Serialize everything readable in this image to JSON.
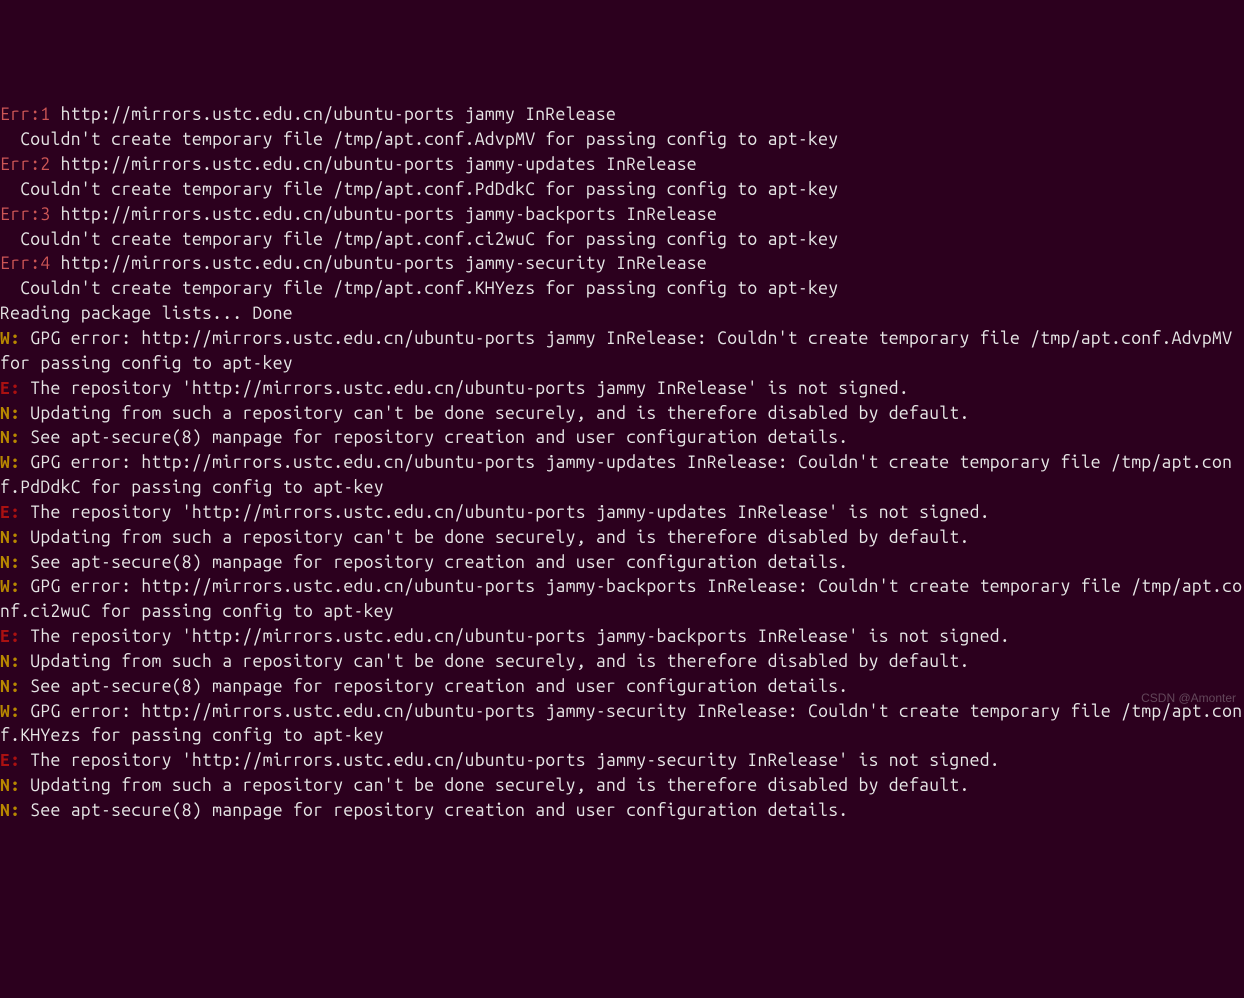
{
  "lines": [
    {
      "type": "err",
      "prefix": "Err:1",
      "text": " http://mirrors.ustc.edu.cn/ubuntu-ports jammy InRelease"
    },
    {
      "type": "plain",
      "text": "  Couldn't create temporary file /tmp/apt.conf.AdvpMV for passing config to apt-key"
    },
    {
      "type": "err",
      "prefix": "Err:2",
      "text": " http://mirrors.ustc.edu.cn/ubuntu-ports jammy-updates InRelease"
    },
    {
      "type": "plain",
      "text": "  Couldn't create temporary file /tmp/apt.conf.PdDdkC for passing config to apt-key"
    },
    {
      "type": "err",
      "prefix": "Err:3",
      "text": " http://mirrors.ustc.edu.cn/ubuntu-ports jammy-backports InRelease"
    },
    {
      "type": "plain",
      "text": "  Couldn't create temporary file /tmp/apt.conf.ci2wuC for passing config to apt-key"
    },
    {
      "type": "err",
      "prefix": "Err:4",
      "text": " http://mirrors.ustc.edu.cn/ubuntu-ports jammy-security InRelease"
    },
    {
      "type": "plain",
      "text": "  Couldn't create temporary file /tmp/apt.conf.KHYezs for passing config to apt-key"
    },
    {
      "type": "plain",
      "text": "Reading package lists... Done"
    },
    {
      "type": "w",
      "prefix": "W:",
      "text": " GPG error: http://mirrors.ustc.edu.cn/ubuntu-ports jammy InRelease: Couldn't create temporary file /tmp/apt.conf.AdvpMV for passing config to apt-key"
    },
    {
      "type": "e",
      "prefix": "E:",
      "text": " The repository 'http://mirrors.ustc.edu.cn/ubuntu-ports jammy InRelease' is not signed."
    },
    {
      "type": "n",
      "prefix": "N:",
      "text": " Updating from such a repository can't be done securely, and is therefore disabled by default."
    },
    {
      "type": "n",
      "prefix": "N:",
      "text": " See apt-secure(8) manpage for repository creation and user configuration details."
    },
    {
      "type": "w",
      "prefix": "W:",
      "text": " GPG error: http://mirrors.ustc.edu.cn/ubuntu-ports jammy-updates InRelease: Couldn't create temporary file /tmp/apt.conf.PdDdkC for passing config to apt-key"
    },
    {
      "type": "e",
      "prefix": "E:",
      "text": " The repository 'http://mirrors.ustc.edu.cn/ubuntu-ports jammy-updates InRelease' is not signed."
    },
    {
      "type": "n",
      "prefix": "N:",
      "text": " Updating from such a repository can't be done securely, and is therefore disabled by default."
    },
    {
      "type": "n",
      "prefix": "N:",
      "text": " See apt-secure(8) manpage for repository creation and user configuration details."
    },
    {
      "type": "w",
      "prefix": "W:",
      "text": " GPG error: http://mirrors.ustc.edu.cn/ubuntu-ports jammy-backports InRelease: Couldn't create temporary file /tmp/apt.conf.ci2wuC for passing config to apt-key"
    },
    {
      "type": "e",
      "prefix": "E:",
      "text": " The repository 'http://mirrors.ustc.edu.cn/ubuntu-ports jammy-backports InRelease' is not signed."
    },
    {
      "type": "n",
      "prefix": "N:",
      "text": " Updating from such a repository can't be done securely, and is therefore disabled by default."
    },
    {
      "type": "n",
      "prefix": "N:",
      "text": " See apt-secure(8) manpage for repository creation and user configuration details."
    },
    {
      "type": "w",
      "prefix": "W:",
      "text": " GPG error: http://mirrors.ustc.edu.cn/ubuntu-ports jammy-security InRelease: Couldn't create temporary file /tmp/apt.conf.KHYezs for passing config to apt-key"
    },
    {
      "type": "e",
      "prefix": "E:",
      "text": " The repository 'http://mirrors.ustc.edu.cn/ubuntu-ports jammy-security InRelease' is not signed."
    },
    {
      "type": "n",
      "prefix": "N:",
      "text": " Updating from such a repository can't be done securely, and is therefore disabled by default."
    },
    {
      "type": "n",
      "prefix": "N:",
      "text": " See apt-secure(8) manpage for repository creation and user configuration details."
    }
  ],
  "watermark": "CSDN @Amonter"
}
